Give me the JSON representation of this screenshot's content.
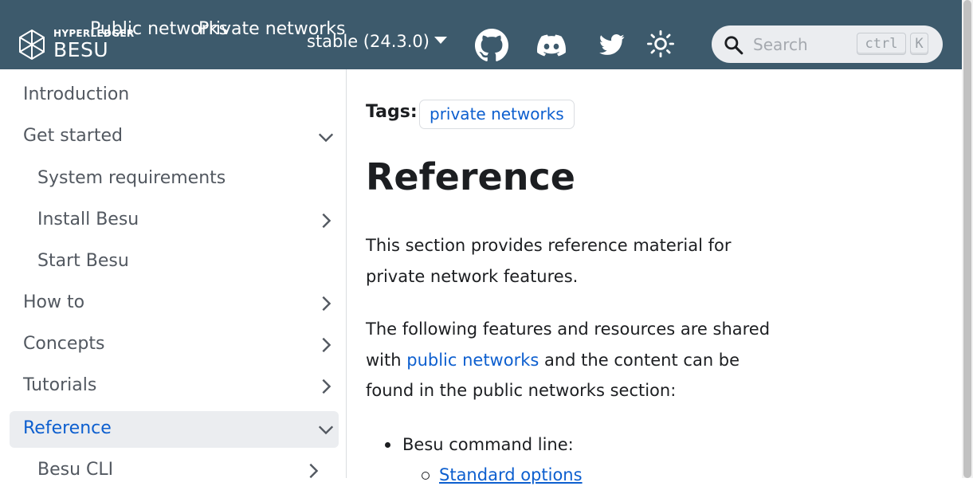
{
  "navbar": {
    "logo_small": "HYPERLEDGER",
    "logo_big": "BESU",
    "public_networks": "Public networks",
    "private_networks": "Private networks",
    "version": "stable (24.3.0)",
    "icons": [
      "github-icon",
      "discord-icon",
      "twitter-icon",
      "theme-toggle-icon"
    ],
    "search": {
      "placeholder": "Search",
      "shortcut_1": "ctrl",
      "shortcut_2": "K"
    },
    "background": "#3d5a6c"
  },
  "sidebar": {
    "items": [
      {
        "label": "Introduction"
      },
      {
        "label": "Get started",
        "chevron": "down"
      },
      {
        "label": "System requirements"
      },
      {
        "label": "Install Besu",
        "chevron": "right"
      },
      {
        "label": "Start Besu"
      },
      {
        "label": "How to",
        "chevron": "right"
      },
      {
        "label": "Concepts",
        "chevron": "right"
      },
      {
        "label": "Tutorials",
        "chevron": "right"
      },
      {
        "label": "Reference",
        "chevron": "down",
        "active": true
      },
      {
        "label": "Besu CLI",
        "chevron": "right"
      }
    ]
  },
  "content": {
    "tags_label": "Tags:",
    "tag": "private networks",
    "title": "Reference",
    "para1": "This section provides reference material for private network features.",
    "para2_before": "The following features and resources are shared with ",
    "para2_link": "public networks",
    "para2_after": " and the content can be found in the public networks section:",
    "list_item_1": "Besu command line:",
    "sub_item_1": "Standard options"
  },
  "colors": {
    "accent": "#0d5fcf",
    "text": "#1c1e21",
    "sidebar_text": "#525860",
    "active_bg": "#ebedf0"
  }
}
